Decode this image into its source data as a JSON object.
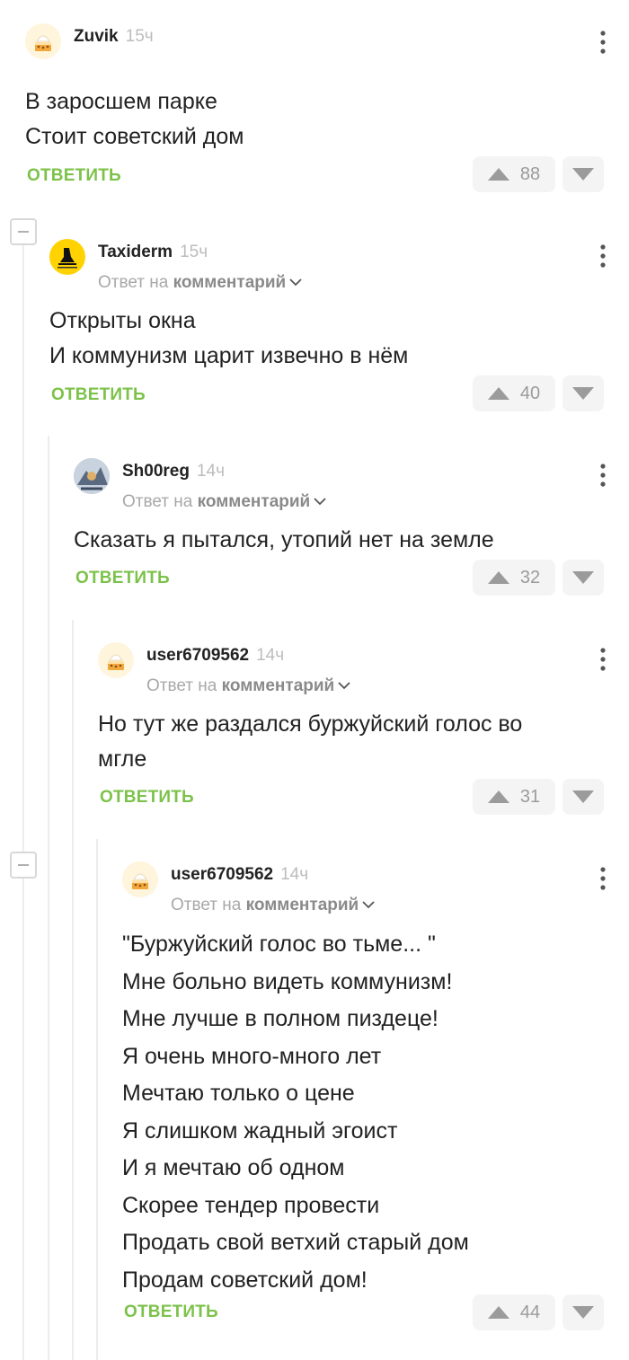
{
  "comments": [
    {
      "author": "Zuvik",
      "age": "15ч",
      "lines": [
        "В заросшем парке",
        "Стоит советский дом"
      ],
      "reply_label": "ОТВЕТИТЬ",
      "votes": "88"
    },
    {
      "author": "Taxiderm",
      "age": "15ч",
      "reply_prefix": "Ответ на",
      "reply_target": "комментарий",
      "lines": [
        "Открыты окна",
        "И коммунизм царит извечно в нём"
      ],
      "reply_label": "ОТВЕТИТЬ",
      "votes": "40"
    },
    {
      "author": "Sh00reg",
      "age": "14ч",
      "reply_prefix": "Ответ на",
      "reply_target": "комментарий",
      "lines": [
        "Сказать я пытался, утопий нет на земле"
      ],
      "reply_label": "ОТВЕТИТЬ",
      "votes": "32"
    },
    {
      "author": "user6709562",
      "age": "14ч",
      "reply_prefix": "Ответ на",
      "reply_target": "комментарий",
      "lines": [
        "Но тут же раздался буржуйский голос во",
        "мгле"
      ],
      "reply_label": "ОТВЕТИТЬ",
      "votes": "31"
    },
    {
      "author": "user6709562",
      "age": "14ч",
      "reply_prefix": "Ответ на",
      "reply_target": "комментарий",
      "lines": [
        "\"Буржуйский голос во тьме... \"",
        "Мне больно видеть коммунизм!",
        "Мне лучше в полном пиздеце!",
        "Я очень много-много лет",
        "Мечтаю только о цене",
        "Я слишком жадный эгоист",
        "И я мечтаю об одном",
        "Скорее тендер провести",
        "Продать свой ветхий старый дом",
        "Продам советский дом!"
      ],
      "reply_label": "ОТВЕТИТЬ",
      "votes": "44"
    }
  ],
  "colors": {
    "reply_green": "#7cc24a",
    "vote_bg": "#f4f4f4",
    "vote_icon": "#9b9b9b"
  },
  "icons": {
    "menu": "more-vertical-icon",
    "upvote": "arrow-up-icon",
    "downvote": "arrow-down-icon",
    "collapse": "collapse-minus-icon",
    "chevron": "chevron-down-icon"
  }
}
